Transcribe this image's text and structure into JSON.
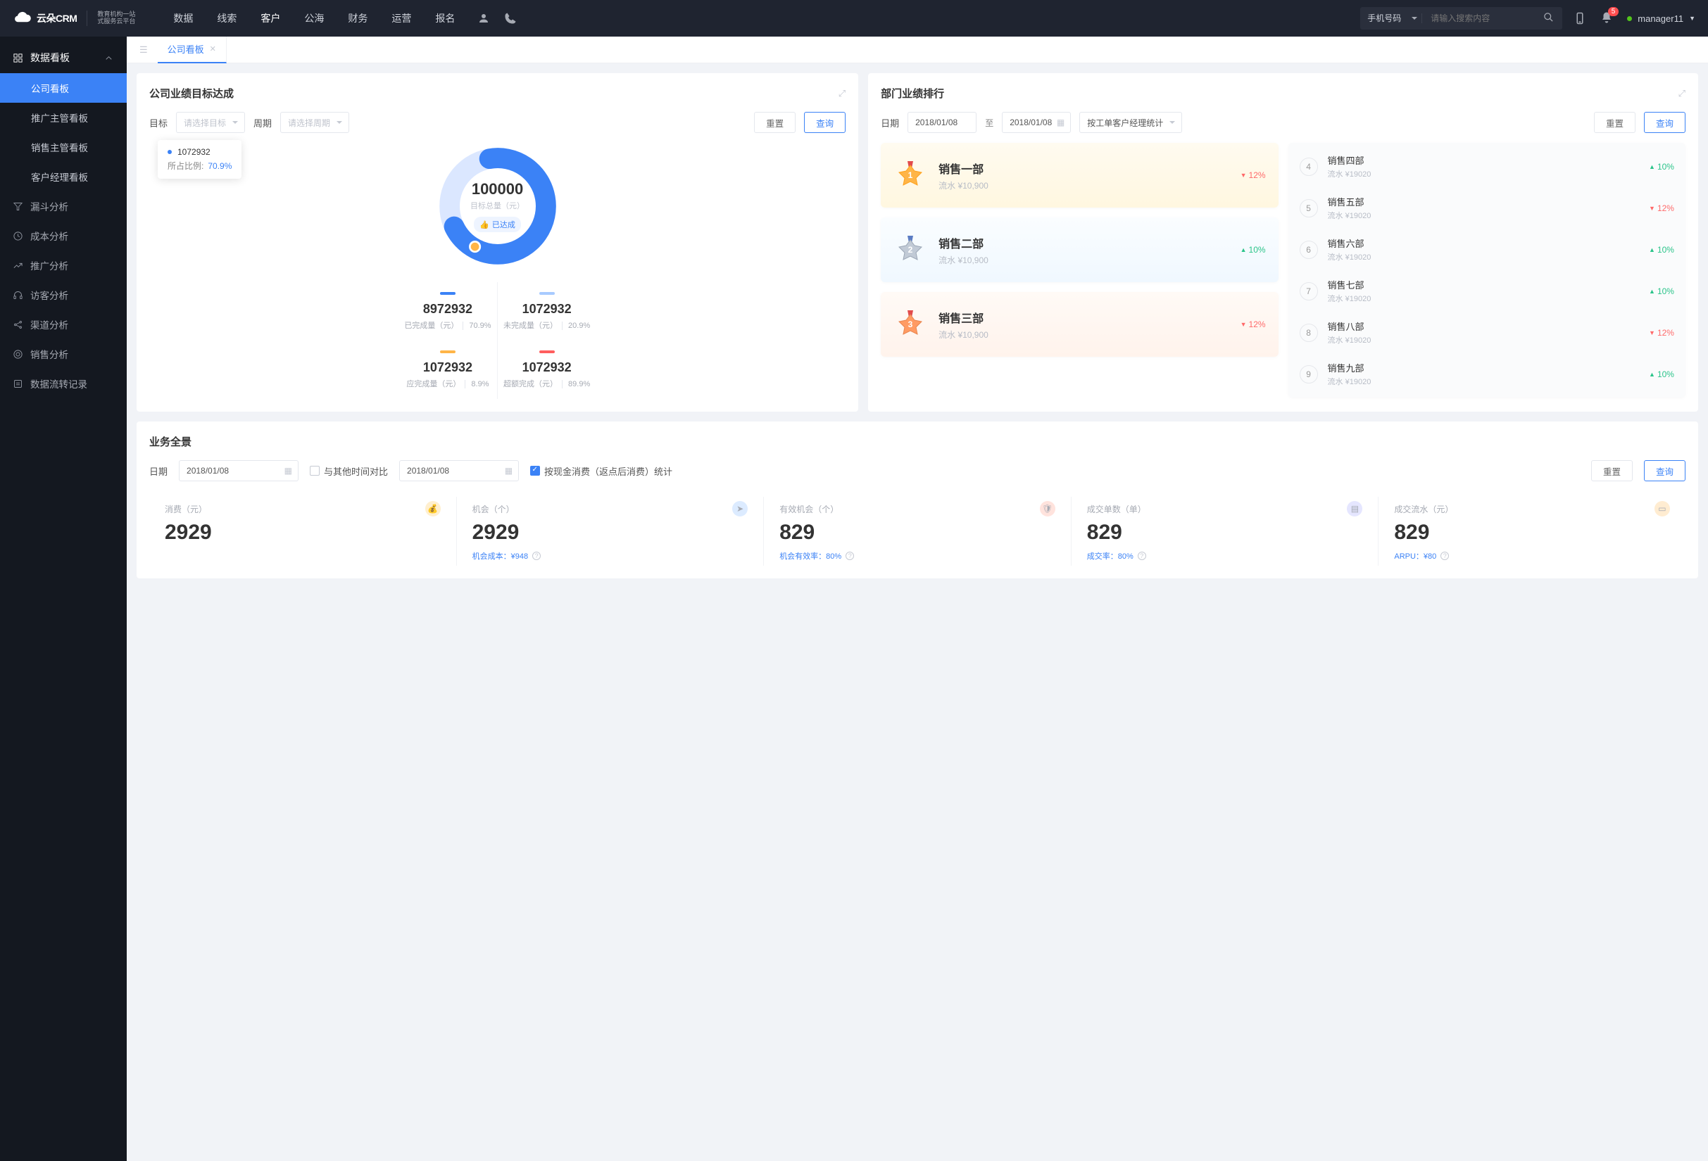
{
  "header": {
    "logo_text": "云朵CRM",
    "logo_sub1": "教育机构一站",
    "logo_sub2": "式服务云平台",
    "nav": [
      "数据",
      "线索",
      "客户",
      "公海",
      "财务",
      "运营",
      "报名"
    ],
    "search_type": "手机号码",
    "search_ph": "请输入搜索内容",
    "badge": "5",
    "user": "manager11"
  },
  "sidebar": {
    "group": "数据看板",
    "items": [
      "公司看板",
      "推广主管看板",
      "销售主管看板",
      "客户经理看板"
    ],
    "rows": [
      "漏斗分析",
      "成本分析",
      "推广分析",
      "访客分析",
      "渠道分析",
      "销售分析",
      "数据流转记录"
    ]
  },
  "tab": "公司看板",
  "target": {
    "title": "公司业绩目标达成",
    "lbl_goal": "目标",
    "ph_goal": "请选择目标",
    "lbl_period": "周期",
    "ph_period": "请选择周期",
    "btn_reset": "重置",
    "btn_query": "查询",
    "tt_value": "1072932",
    "tt_lbl": "所占比例:",
    "tt_pct": "70.9%",
    "total": "100000",
    "total_lbl": "目标总量（元）",
    "ach": "已达成",
    "metrics": [
      {
        "v": "8972932",
        "l": "已完成量（元）",
        "p": "70.9%"
      },
      {
        "v": "1072932",
        "l": "未完成量（元）",
        "p": "20.9%"
      },
      {
        "v": "1072932",
        "l": "应完成量（元）",
        "p": "8.9%"
      },
      {
        "v": "1072932",
        "l": "超额完成（元）",
        "p": "89.9%"
      }
    ]
  },
  "ranking": {
    "title": "部门业绩排行",
    "lbl_date": "日期",
    "date1": "2018/01/08",
    "to": "至",
    "date2": "2018/01/08",
    "stat_by": "按工单客户经理统计",
    "btn_reset": "重置",
    "btn_query": "查询",
    "top": [
      {
        "name": "销售一部",
        "sub": "流水 ¥10,900",
        "pct": "12%",
        "dir": "down"
      },
      {
        "name": "销售二部",
        "sub": "流水 ¥10,900",
        "pct": "10%",
        "dir": "up"
      },
      {
        "name": "销售三部",
        "sub": "流水 ¥10,900",
        "pct": "12%",
        "dir": "down"
      }
    ],
    "rest": [
      {
        "idx": "4",
        "name": "销售四部",
        "sub": "流水 ¥19020",
        "pct": "10%",
        "dir": "up"
      },
      {
        "idx": "5",
        "name": "销售五部",
        "sub": "流水 ¥19020",
        "pct": "12%",
        "dir": "down"
      },
      {
        "idx": "6",
        "name": "销售六部",
        "sub": "流水 ¥19020",
        "pct": "10%",
        "dir": "up"
      },
      {
        "idx": "7",
        "name": "销售七部",
        "sub": "流水 ¥19020",
        "pct": "10%",
        "dir": "up"
      },
      {
        "idx": "8",
        "name": "销售八部",
        "sub": "流水 ¥19020",
        "pct": "12%",
        "dir": "down"
      },
      {
        "idx": "9",
        "name": "销售九部",
        "sub": "流水 ¥19020",
        "pct": "10%",
        "dir": "up"
      }
    ]
  },
  "overview": {
    "title": "业务全景",
    "lbl_date": "日期",
    "date1": "2018/01/08",
    "compare": "与其他时间对比",
    "date2": "2018/01/08",
    "cash": "按现金消费（返点后消费）统计",
    "btn_reset": "重置",
    "btn_query": "查询",
    "stats": [
      {
        "h": "消费（元）",
        "v": "2929",
        "f": ""
      },
      {
        "h": "机会（个）",
        "v": "2929",
        "f": "机会成本：¥948"
      },
      {
        "h": "有效机会（个）",
        "v": "829",
        "f": "机会有效率：80%"
      },
      {
        "h": "成交单数（单）",
        "v": "829",
        "f": "成交率：80%"
      },
      {
        "h": "成交流水（元）",
        "v": "829",
        "f": "ARPU：¥80"
      }
    ]
  },
  "chart_data": {
    "type": "pie",
    "title": "目标总量（元）",
    "total": 100000,
    "series": [
      {
        "name": "已完成量",
        "value": 8972932,
        "pct": 70.9,
        "color": "#3b82f6"
      },
      {
        "name": "未完成量",
        "value": 1072932,
        "pct": 20.9,
        "color": "#a8cbff"
      },
      {
        "name": "应完成量",
        "value": 1072932,
        "pct": 8.9,
        "color": "#ffb547"
      },
      {
        "name": "超额完成",
        "value": 1072932,
        "pct": 89.9,
        "color": "#ff5e5e"
      }
    ]
  }
}
